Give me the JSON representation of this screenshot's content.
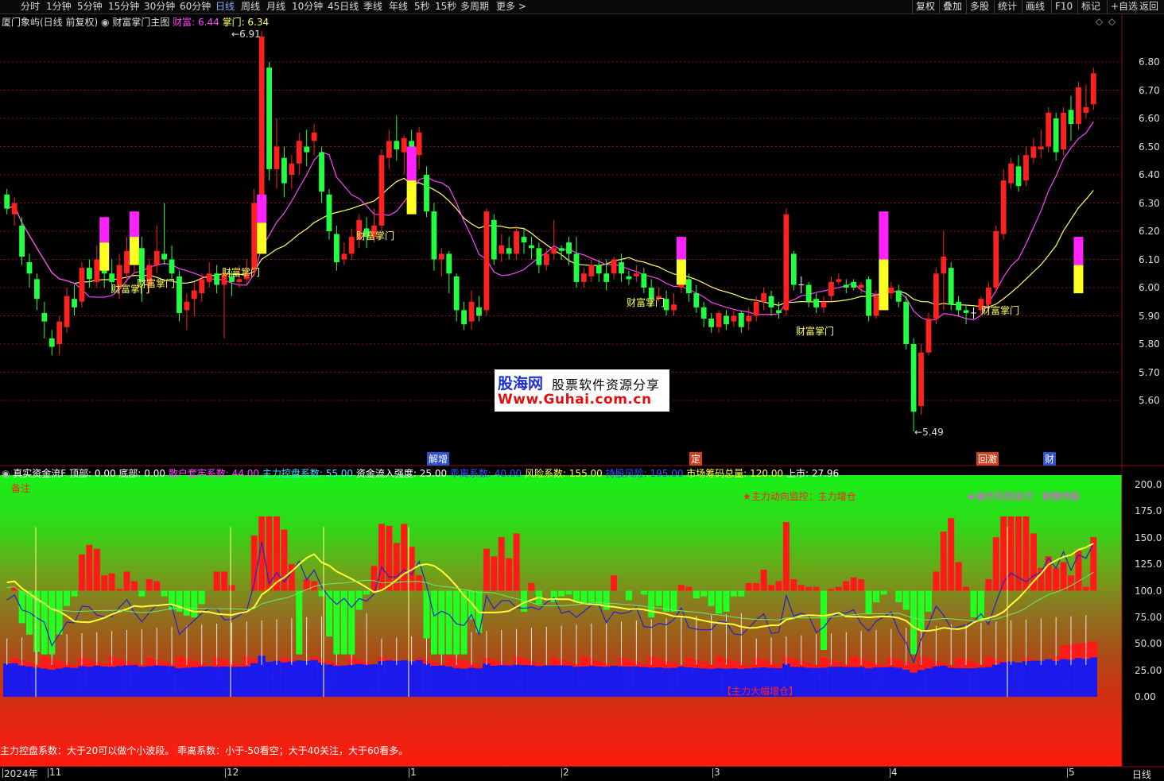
{
  "toolbar": {
    "periods": [
      "分时",
      "1分钟",
      "5分钟",
      "15分钟",
      "30分钟",
      "60分钟",
      "日线",
      "周线",
      "月线",
      "10分钟",
      "45日线",
      "季线",
      "年线",
      "5秒",
      "15秒",
      "多周期",
      "更多 >"
    ],
    "active": "日线",
    "right_buttons": [
      "复权",
      "叠加",
      "多股",
      "统计",
      "画线",
      "F10",
      "标记",
      "+自选",
      "返回"
    ]
  },
  "main_chart": {
    "stock": "厦门象屿(日线 前复权)",
    "indicator": "财富掌门主图",
    "caifu_label": "财富: 6.44",
    "zhangmen_label": "掌门: 6.34",
    "price_ticks": [
      "6.80",
      "6.70",
      "6.60",
      "6.50",
      "6.40",
      "6.30",
      "6.20",
      "6.10",
      "6.00",
      "5.90",
      "5.80",
      "5.70",
      "5.60"
    ],
    "high_mark": "6.91",
    "low_mark": "5.49",
    "signal_label": "财富掌门",
    "event_tags": [
      "解增",
      "定",
      "回激",
      "财"
    ]
  },
  "watermark": {
    "brand": "股海网",
    "slogan": "股票软件资源分享",
    "url": "Www.Guhai.com.cn"
  },
  "indicator_panel": {
    "name": "真实资金流F",
    "items": [
      {
        "text": "顶部: 0.00",
        "color": "#ffffff"
      },
      {
        "text": "底部: 0.00",
        "color": "#ffffff"
      },
      {
        "text": "散户套牢系数: 44.00",
        "color": "#ff44ff"
      },
      {
        "text": "主力控盘系数: 55.00",
        "color": "#44ddff"
      },
      {
        "text": "资金流入强度: 25.00",
        "color": "#ffffff"
      },
      {
        "text": "乖离系数: 40.00",
        "color": "#3355ff"
      },
      {
        "text": "风险系数: 155.00",
        "color": "#ffff44"
      },
      {
        "text": "持股风险: 195.00",
        "color": "#3355ff"
      },
      {
        "text": "市场筹码总量: 120.00",
        "color": "#ffff44"
      },
      {
        "text": "上市: 27.96",
        "color": "#ffffff"
      }
    ],
    "note_top_left": "备注",
    "monitor": "★主力动向监控：主力增仓",
    "risk_tip": "★操作风险提示：稳健持股",
    "bottom_box": "【主力大幅增仓】",
    "ticks": [
      "200.0",
      "175.0",
      "150.0",
      "125.0",
      "100.0",
      "75.00",
      "50.00",
      "25.00",
      "0.00"
    ],
    "bottom_note": "主力控盘系数：大于20可以做个小波段。      乖离系数：小于-50看空；大于40关注，大于60看多。"
  },
  "date_axis": {
    "labels": [
      "2024年",
      "11",
      "12",
      "1",
      "2",
      "3",
      "4",
      "5"
    ],
    "period_label": "日线"
  },
  "colors": {
    "up": "#ff2020",
    "down": "#20ff40",
    "ma_fast": "#ffff66",
    "ma_slow": "#ff44ff",
    "grid": "#8a1010"
  }
}
